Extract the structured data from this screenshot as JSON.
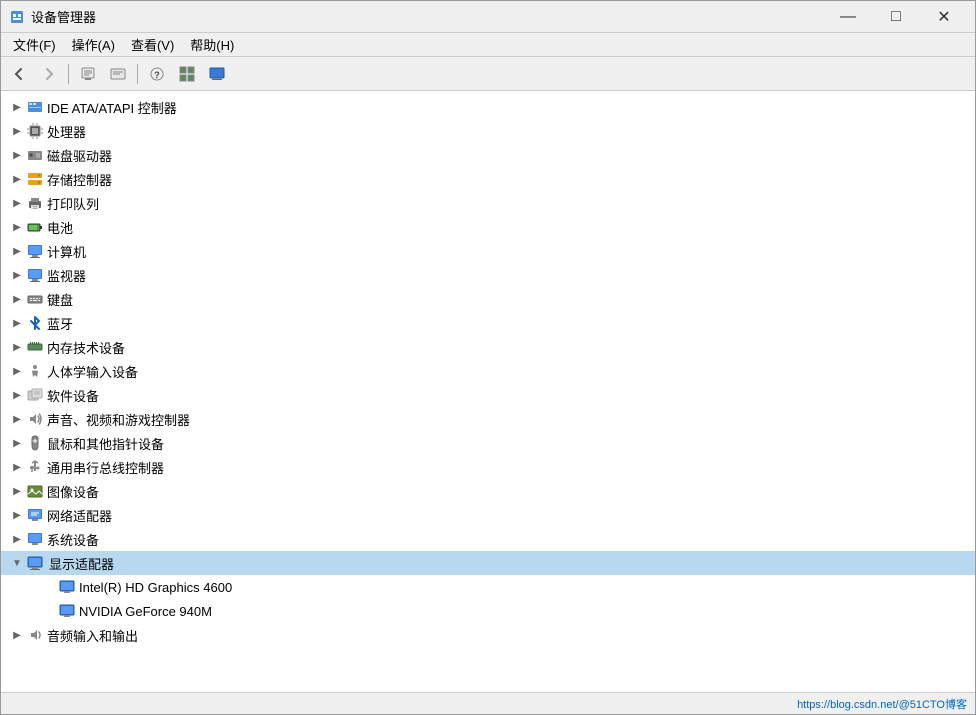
{
  "window": {
    "title": "设备管理器",
    "icon": "⚙"
  },
  "titlebar": {
    "minimize_label": "—",
    "maximize_label": "□",
    "close_label": "✕"
  },
  "menubar": {
    "items": [
      {
        "label": "文件(F)"
      },
      {
        "label": "操作(A)"
      },
      {
        "label": "查看(V)"
      },
      {
        "label": "帮助(H)"
      }
    ]
  },
  "toolbar": {
    "buttons": [
      {
        "name": "back",
        "icon": "←"
      },
      {
        "name": "forward",
        "icon": "→"
      },
      {
        "name": "properties",
        "icon": "📄"
      },
      {
        "name": "update-driver",
        "icon": "📋"
      },
      {
        "name": "help",
        "icon": "?"
      },
      {
        "name": "unknown",
        "icon": "⊞"
      },
      {
        "name": "monitor",
        "icon": "🖥"
      }
    ]
  },
  "tree": {
    "items": [
      {
        "label": "IDE ATA/ATAPI 控制器",
        "icon": "ide",
        "expanded": false,
        "indent": 1
      },
      {
        "label": "处理器",
        "icon": "cpu",
        "expanded": false,
        "indent": 1
      },
      {
        "label": "磁盘驱动器",
        "icon": "disk",
        "expanded": false,
        "indent": 1
      },
      {
        "label": "存储控制器",
        "icon": "storage",
        "expanded": false,
        "indent": 1
      },
      {
        "label": "打印队列",
        "icon": "printer",
        "expanded": false,
        "indent": 1
      },
      {
        "label": "电池",
        "icon": "battery",
        "expanded": false,
        "indent": 1
      },
      {
        "label": "计算机",
        "icon": "computer",
        "expanded": false,
        "indent": 1
      },
      {
        "label": "监视器",
        "icon": "monitor",
        "expanded": false,
        "indent": 1
      },
      {
        "label": "键盘",
        "icon": "keyboard",
        "expanded": false,
        "indent": 1
      },
      {
        "label": "蓝牙",
        "icon": "bluetooth",
        "expanded": false,
        "indent": 1
      },
      {
        "label": "内存技术设备",
        "icon": "memory",
        "expanded": false,
        "indent": 1
      },
      {
        "label": "人体学输入设备",
        "icon": "human",
        "expanded": false,
        "indent": 1
      },
      {
        "label": "软件设备",
        "icon": "software",
        "expanded": false,
        "indent": 1
      },
      {
        "label": "声音、视频和游戏控制器",
        "icon": "sound",
        "expanded": false,
        "indent": 1
      },
      {
        "label": "鼠标和其他指针设备",
        "icon": "mouse",
        "expanded": false,
        "indent": 1
      },
      {
        "label": "通用串行总线控制器",
        "icon": "usb",
        "expanded": false,
        "indent": 1
      },
      {
        "label": "图像设备",
        "icon": "image",
        "expanded": false,
        "indent": 1
      },
      {
        "label": "网络适配器",
        "icon": "network",
        "expanded": false,
        "indent": 1
      },
      {
        "label": "系统设备",
        "icon": "system",
        "expanded": false,
        "indent": 1
      },
      {
        "label": "显示适配器",
        "icon": "display",
        "expanded": true,
        "selected": true,
        "indent": 1
      },
      {
        "label": "Intel(R) HD Graphics 4600",
        "icon": "intel",
        "expanded": false,
        "indent": 2
      },
      {
        "label": "NVIDIA GeForce 940M",
        "icon": "nvidia",
        "expanded": false,
        "indent": 2
      },
      {
        "label": "音频输入和输出",
        "icon": "audio",
        "expanded": false,
        "indent": 1
      }
    ]
  },
  "statusbar": {
    "text": "https://blog.csdn.net/@51CTO博客"
  }
}
